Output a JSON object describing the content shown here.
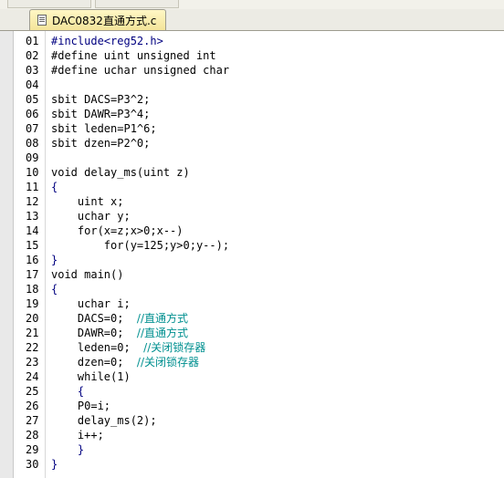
{
  "tab": {
    "filename": "DAC0832直通方式.c"
  },
  "code_lines": [
    {
      "n": "01",
      "segments": [
        {
          "t": "#include<reg52.h>",
          "c": "preproc"
        }
      ]
    },
    {
      "n": "02",
      "segments": [
        {
          "t": "#define uint unsigned int",
          "c": "plain"
        }
      ]
    },
    {
      "n": "03",
      "segments": [
        {
          "t": "#define uchar unsigned char",
          "c": "plain"
        }
      ]
    },
    {
      "n": "04",
      "segments": []
    },
    {
      "n": "05",
      "segments": [
        {
          "t": "sbit DACS=P3^2;",
          "c": "plain"
        }
      ]
    },
    {
      "n": "06",
      "segments": [
        {
          "t": "sbit DAWR=P3^4;",
          "c": "plain"
        }
      ]
    },
    {
      "n": "07",
      "segments": [
        {
          "t": "sbit leden=P1^6;",
          "c": "plain"
        }
      ]
    },
    {
      "n": "08",
      "segments": [
        {
          "t": "sbit dzen=P2^0;",
          "c": "plain"
        }
      ]
    },
    {
      "n": "09",
      "segments": []
    },
    {
      "n": "10",
      "segments": [
        {
          "t": "void delay_ms(uint z)",
          "c": "plain"
        }
      ]
    },
    {
      "n": "11",
      "segments": [
        {
          "t": "{",
          "c": "op"
        }
      ]
    },
    {
      "n": "12",
      "segments": [
        {
          "t": "    uint x;",
          "c": "plain"
        }
      ]
    },
    {
      "n": "13",
      "segments": [
        {
          "t": "    uchar y;",
          "c": "plain"
        }
      ]
    },
    {
      "n": "14",
      "segments": [
        {
          "t": "    for(x=z;x>0;x--)",
          "c": "plain"
        }
      ]
    },
    {
      "n": "15",
      "segments": [
        {
          "t": "        for(y=125;y>0;y--);",
          "c": "plain"
        }
      ]
    },
    {
      "n": "16",
      "segments": [
        {
          "t": "}",
          "c": "op"
        }
      ]
    },
    {
      "n": "17",
      "segments": [
        {
          "t": "void main()",
          "c": "plain"
        }
      ]
    },
    {
      "n": "18",
      "segments": [
        {
          "t": "{",
          "c": "op"
        }
      ]
    },
    {
      "n": "19",
      "segments": [
        {
          "t": "    uchar i;",
          "c": "plain"
        }
      ]
    },
    {
      "n": "20",
      "segments": [
        {
          "t": "    DACS=0;  ",
          "c": "plain"
        },
        {
          "t": "//直通方式",
          "c": "comment"
        }
      ]
    },
    {
      "n": "21",
      "segments": [
        {
          "t": "    DAWR=0;  ",
          "c": "plain"
        },
        {
          "t": "//直通方式",
          "c": "comment"
        }
      ]
    },
    {
      "n": "22",
      "segments": [
        {
          "t": "    leden=0;  ",
          "c": "plain"
        },
        {
          "t": "//关闭锁存器",
          "c": "comment"
        }
      ]
    },
    {
      "n": "23",
      "segments": [
        {
          "t": "    dzen=0;  ",
          "c": "plain"
        },
        {
          "t": "//关闭锁存器",
          "c": "comment"
        }
      ]
    },
    {
      "n": "24",
      "segments": [
        {
          "t": "    while(1)",
          "c": "plain"
        }
      ]
    },
    {
      "n": "25",
      "segments": [
        {
          "t": "    {",
          "c": "op"
        }
      ]
    },
    {
      "n": "26",
      "segments": [
        {
          "t": "    P0=i;",
          "c": "plain"
        }
      ]
    },
    {
      "n": "27",
      "segments": [
        {
          "t": "    delay_ms(2);",
          "c": "plain"
        }
      ]
    },
    {
      "n": "28",
      "segments": [
        {
          "t": "    i++;",
          "c": "plain"
        }
      ]
    },
    {
      "n": "29",
      "segments": [
        {
          "t": "    }",
          "c": "op"
        }
      ]
    },
    {
      "n": "30",
      "segments": [
        {
          "t": "}",
          "c": "op"
        }
      ]
    }
  ]
}
